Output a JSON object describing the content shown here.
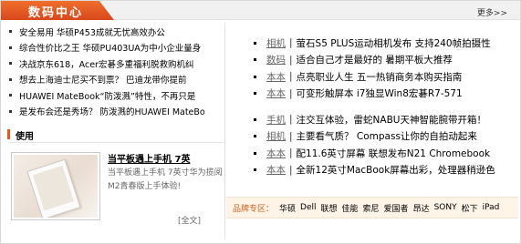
{
  "header": {
    "title": "数码中心",
    "more_label": "更多>>"
  },
  "left_news": [
    "安全易用 华硕P453成就无忧高效办公",
    "综合性价比之王 华硕PU403UA为中小企业量身",
    "决战京东618，Acer宏碁多重福利脱救购机纠",
    "想去上海迪士尼买不到票？ 巴迪龙带你提前",
    "HUAWEI MateBook“防泼溅”特性，不再只是",
    "是发布会还是秀场？ 防泼溅的HUAWEI MateBo"
  ],
  "section": {
    "title": "使用"
  },
  "feature": {
    "title": "当平板遇上手机 7英",
    "description": "当平板遇上手机 7英寸华为揽阅M2青春版上手体验!",
    "more_label": "[全文]"
  },
  "right_news_group1": [
    {
      "category": "相机",
      "title": "萤石S5 PLUS运动相机发布 支持240帧拍摄性"
    },
    {
      "category": "数码",
      "title": "适合自己才是最好的 暑期平板大推荐"
    },
    {
      "category": "本本",
      "title": "点亮职业人生 五一热销商务本购买指南"
    },
    {
      "category": "本本",
      "title": "可变形触屏本 i7独显Win8宏碁R7-571"
    }
  ],
  "right_news_group2": [
    {
      "category": "手机",
      "title": "注交互体验，雷蛇NABU天神智能腕带开箱！"
    },
    {
      "category": "相机",
      "title": "主要看气质？ Compass让你的自拍动起来"
    },
    {
      "category": "本本",
      "title": "配11.6英寸屏幕 联想发布N21 Chromebook"
    },
    {
      "category": "本本",
      "title": "全新12英寸MacBook屏幕出彩，处理器稍逊色"
    }
  ],
  "separator": "|",
  "brand_zone": {
    "label": "品牌专区：",
    "brands": [
      "华硕",
      "Dell",
      "联想",
      "佳能",
      "索尼",
      "爱国者",
      "昂达",
      "SONY",
      "松下",
      "iPad"
    ]
  },
  "colors": {
    "header_orange": "#e05a1c",
    "brand_label": "#c8641e",
    "brand_bar_bg": "#fdf3e7"
  }
}
